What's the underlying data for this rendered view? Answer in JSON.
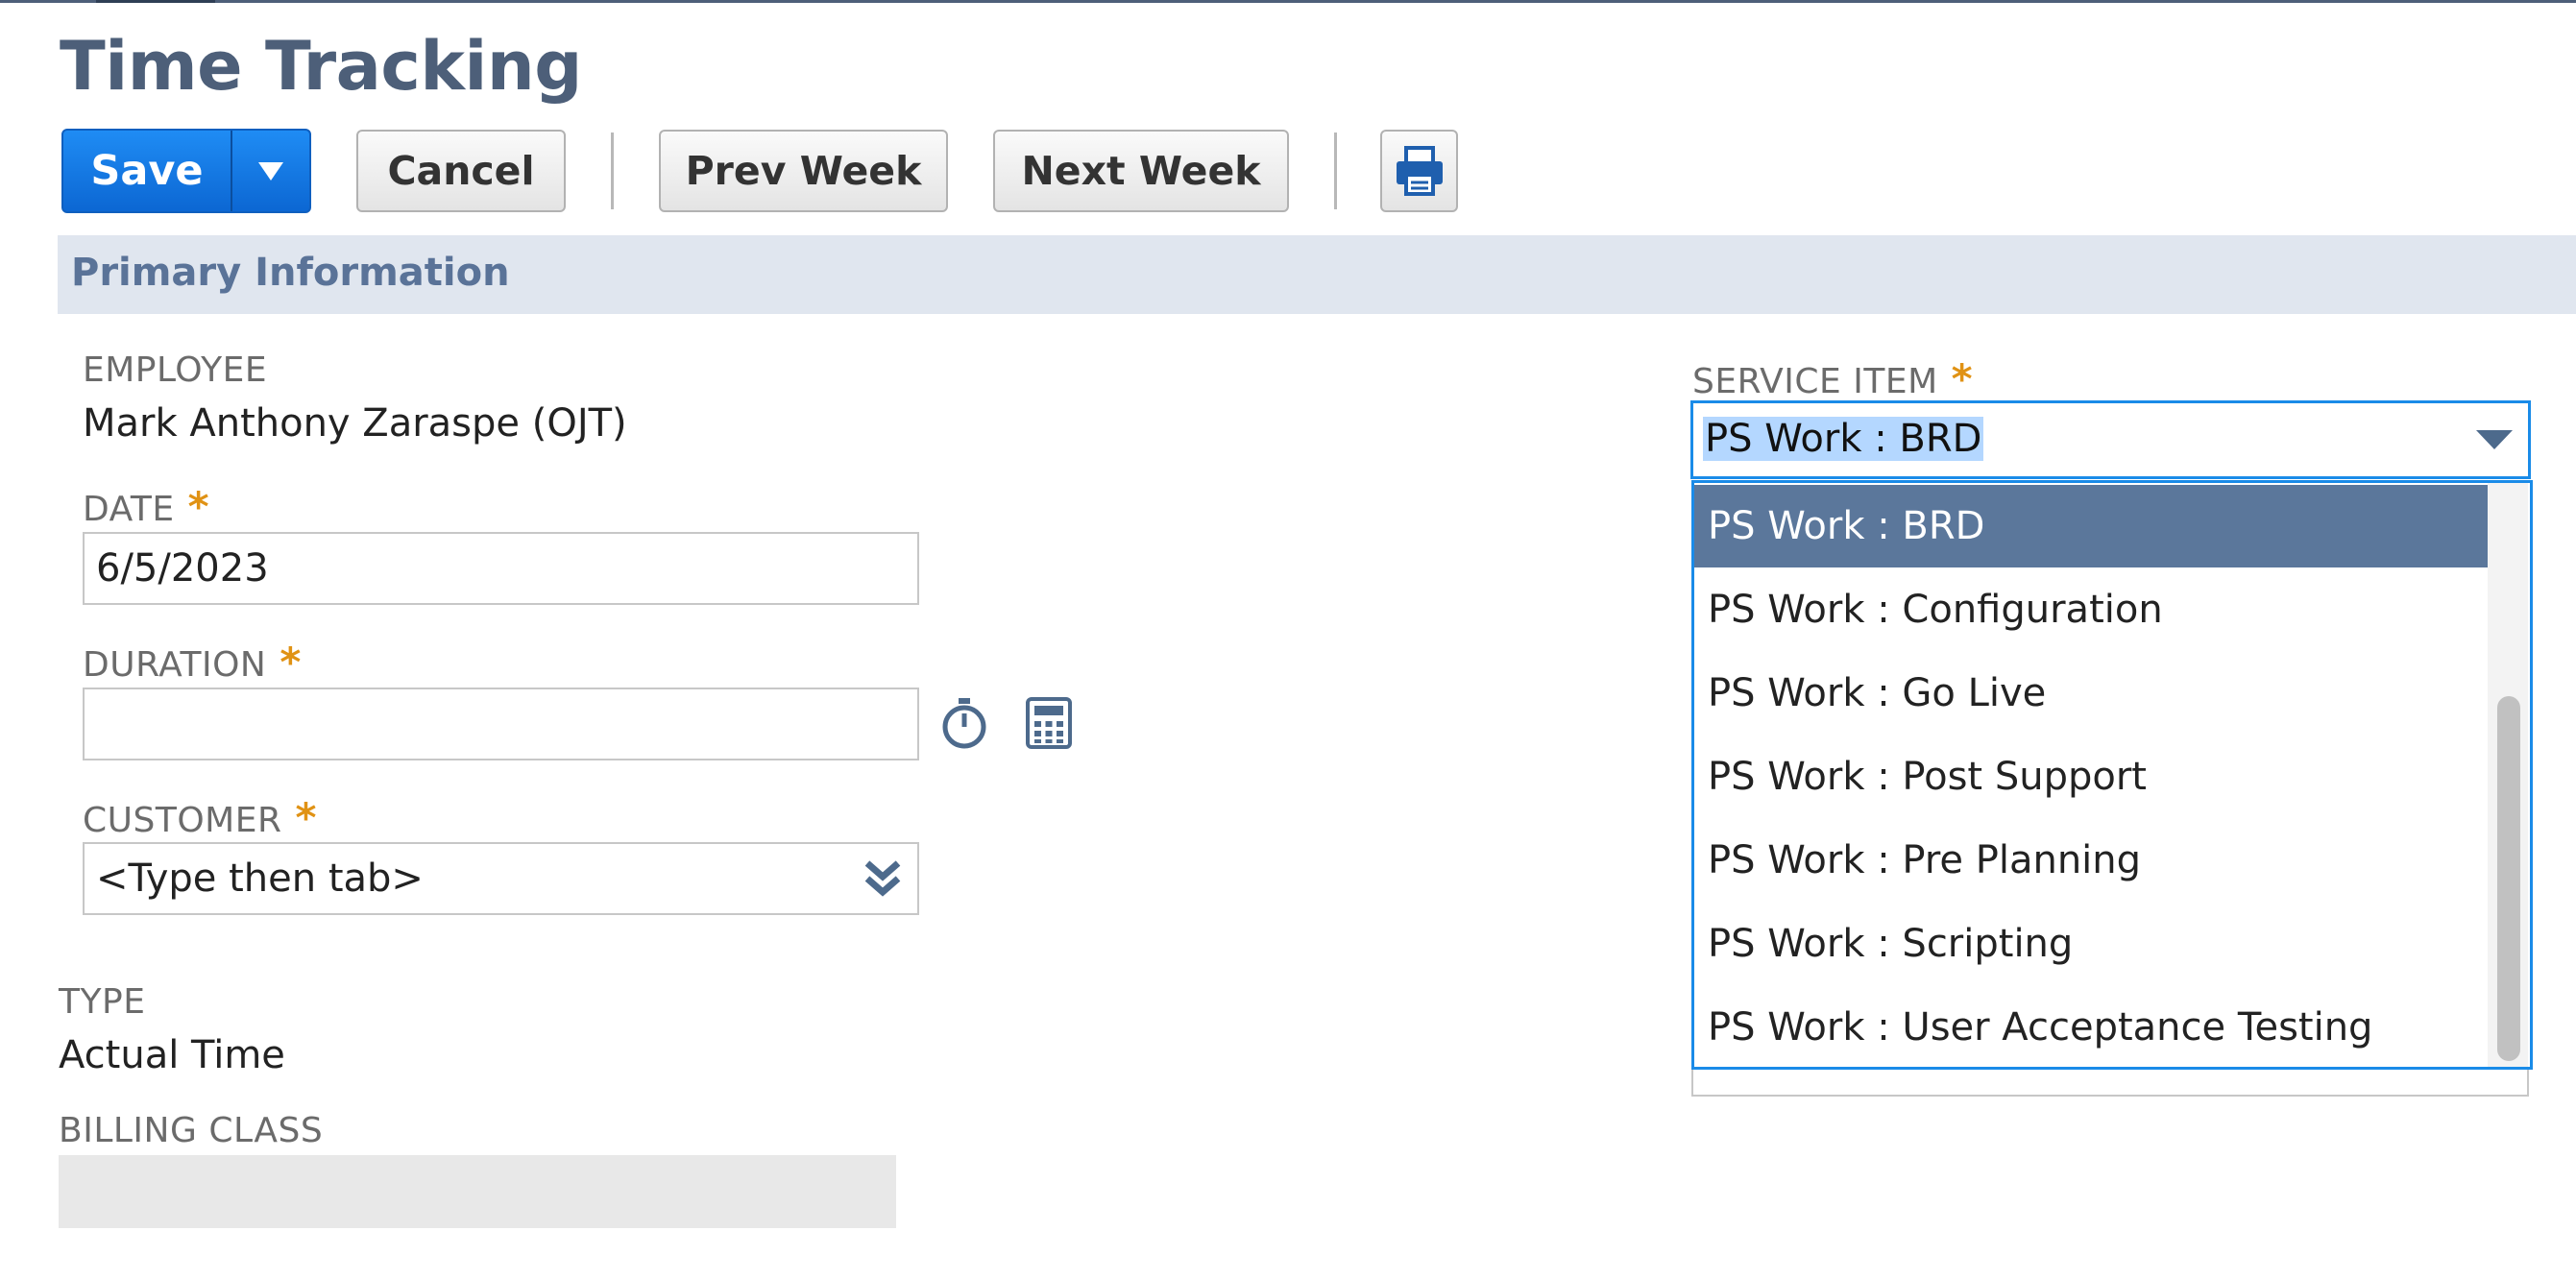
{
  "page": {
    "title": "Time Tracking"
  },
  "toolbar": {
    "save_label": "Save",
    "cancel_label": "Cancel",
    "prev_week_label": "Prev Week",
    "next_week_label": "Next Week"
  },
  "section": {
    "title": "Primary Information"
  },
  "fields": {
    "employee": {
      "label": "EMPLOYEE",
      "value": "Mark Anthony Zaraspe (OJT)"
    },
    "date": {
      "label": "DATE",
      "required": "*",
      "value": "6/5/2023"
    },
    "duration": {
      "label": "DURATION",
      "required": "*",
      "value": ""
    },
    "customer": {
      "label": "CUSTOMER",
      "required": "*",
      "placeholder": "<Type then tab>"
    },
    "type": {
      "label": "TYPE",
      "value": "Actual Time"
    },
    "billing_class": {
      "label": "BILLING CLASS",
      "value": ""
    },
    "service_item": {
      "label": "SERVICE ITEM",
      "required": "*",
      "value": "PS Work : BRD",
      "options": [
        "PS Work : BRD",
        "PS Work : Configuration",
        "PS Work : Go Live",
        "PS Work : Post Support",
        "PS Work : Pre Planning",
        "PS Work : Scripting",
        "PS Work : User Acceptance Testing"
      ]
    }
  },
  "icons": {
    "save_menu": "caret-down-icon",
    "print": "printer-icon",
    "timer": "stopwatch-icon",
    "calculator": "calculator-icon",
    "customer_dropdown": "double-chevron-down-icon",
    "service_dropdown": "caret-down-icon"
  },
  "colors": {
    "title": "#4d5f79",
    "primary_button": "#1478e0",
    "section_bar": "#e0e6ef",
    "required_star": "#e09214",
    "focus_border": "#1a8be8",
    "selected_option": "#5b779b"
  }
}
